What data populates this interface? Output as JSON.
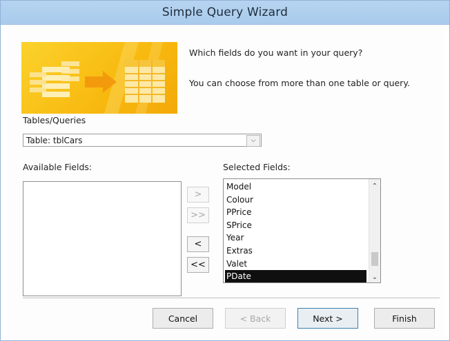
{
  "window": {
    "title": "Simple Query Wizard"
  },
  "header": {
    "prompt_question": "Which fields do you want in your query?",
    "prompt_hint": "You can choose from more than one table or query."
  },
  "tables_queries": {
    "label": "Tables/Queries",
    "selected": "Table: tblCars"
  },
  "available_fields": {
    "label": "Available Fields:",
    "items": []
  },
  "selected_fields": {
    "label": "Selected Fields:",
    "items": [
      "Model",
      "Colour",
      "PPrice",
      "SPrice",
      "Year",
      "Extras",
      "Valet",
      "PDate"
    ],
    "highlighted": "PDate"
  },
  "move_buttons": {
    "add_one": ">",
    "add_all": ">>",
    "remove_one": "<",
    "remove_all": "<<"
  },
  "footer": {
    "cancel": "Cancel",
    "back": "< Back",
    "next": "Next >",
    "finish": "Finish"
  },
  "icons": {
    "combo_arrow": "chevron-down-icon",
    "scroll_up": "chevron-up-icon",
    "scroll_down": "chevron-down-icon",
    "banner": "table-to-query-illustration"
  },
  "colors": {
    "titlebar": "#b6d4f0",
    "banner": "#f8b90f",
    "selection": "#0f0f0f"
  }
}
